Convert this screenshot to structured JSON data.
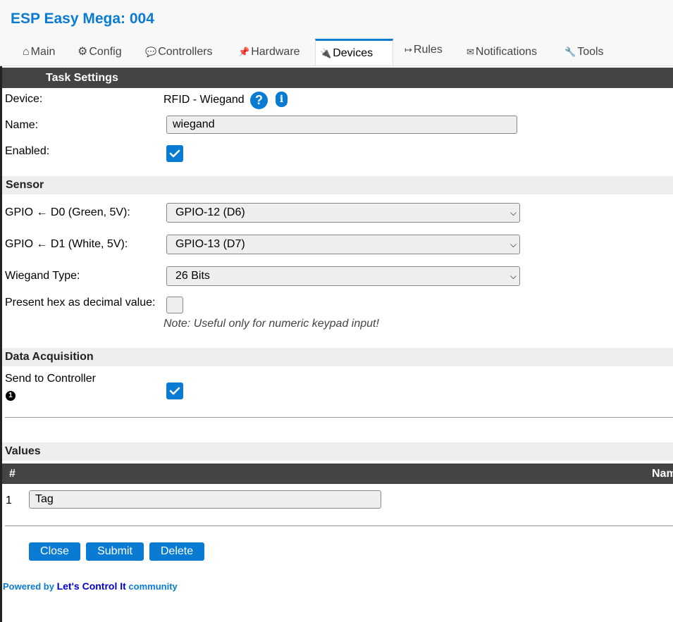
{
  "app": {
    "title": "ESP Easy Mega: 004"
  },
  "tabs": [
    {
      "icon": "⌂",
      "label": "Main"
    },
    {
      "icon": "⚙",
      "label": "Config"
    },
    {
      "icon": "💬",
      "label": "Controllers"
    },
    {
      "icon": "📌",
      "label": "Hardware"
    },
    {
      "icon": "🔌",
      "label": "Devices",
      "active": true
    },
    {
      "icon": "↦",
      "label": "Rules"
    },
    {
      "icon": "✉",
      "label": "Notifications"
    },
    {
      "icon": "🔧",
      "label": "Tools"
    }
  ],
  "task_settings": {
    "header": "Task Settings",
    "device_label": "Device:",
    "device_value": "RFID - Wiegand",
    "help_icon": "?",
    "info_icon": "i",
    "name_label": "Name:",
    "name_value": "wiegand",
    "enabled_label": "Enabled:",
    "enabled": true
  },
  "sensor": {
    "header": "Sensor",
    "gpio_d0_label": "GPIO ← D0 (Green, 5V):",
    "gpio_d0_value": "GPIO-12 (D6)",
    "gpio_d1_label": "GPIO ← D1 (White, 5V):",
    "gpio_d1_value": "GPIO-13 (D7)",
    "wiegand_type_label": "Wiegand Type:",
    "wiegand_type_value": "26 Bits",
    "hex_decimal_label": "Present hex as decimal value:",
    "hex_decimal": false,
    "hex_note": "Note: Useful only for numeric keypad input!"
  },
  "data_acquisition": {
    "header": "Data Acquisition",
    "send_label": "Send to Controller",
    "send_index": "1",
    "send_enabled": true
  },
  "values": {
    "header": "Values",
    "col_num": "#",
    "col_name": "Nam",
    "rows": [
      {
        "num": "1",
        "name": "Tag"
      }
    ]
  },
  "buttons": {
    "close": "Close",
    "submit": "Submit",
    "delete": "Delete"
  },
  "footer": {
    "prefix": "Powered by ",
    "link": "Let's Control It",
    "suffix": " community"
  },
  "colors": {
    "accent": "#0a7bd3",
    "dark_bar": "#444444",
    "light_bar": "#eeeeee"
  }
}
